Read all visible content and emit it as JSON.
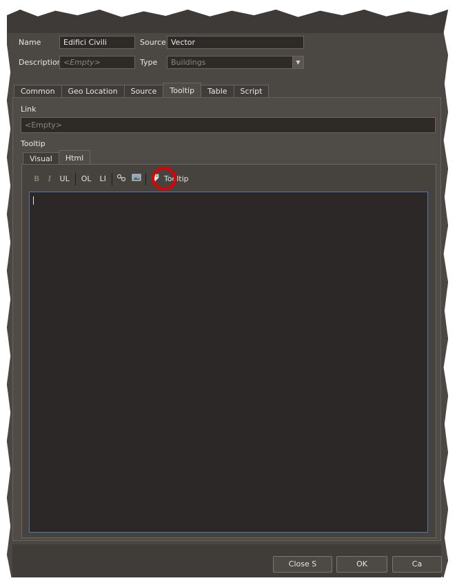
{
  "header": {
    "name_label": "Name",
    "name_value": "Edifici Civili",
    "source_label": "Source",
    "source_value": "Vector",
    "description_label": "Description",
    "description_placeholder": "<Empty>",
    "type_label": "Type",
    "type_value": "Buildings"
  },
  "tabs": [
    {
      "label": "Common"
    },
    {
      "label": "Geo Location"
    },
    {
      "label": "Source"
    },
    {
      "label": "Tooltip"
    },
    {
      "label": "Table"
    },
    {
      "label": "Script"
    }
  ],
  "active_tab": "Tooltip",
  "tooltip_tab": {
    "link_label": "Link",
    "link_placeholder": "<Empty>",
    "tooltip_label": "Tooltip",
    "subtabs": [
      {
        "label": "Visual"
      },
      {
        "label": "Html"
      }
    ],
    "active_subtab": "Html",
    "toolbar": {
      "bold": "B",
      "italic": "I",
      "ul": "UL",
      "ol": "OL",
      "li": "LI",
      "tooltip_label": "Tooltip",
      "icons": [
        "link-icon",
        "image-icon",
        "tag-icon"
      ]
    },
    "editor_value": ""
  },
  "buttons": {
    "close_label": "Close S",
    "ok_label": "OK",
    "cancel_label": "Ca"
  },
  "colors": {
    "accent_highlight": "#e00000",
    "editor_border": "#5577a8",
    "panel_bg": "#4f4b47"
  }
}
